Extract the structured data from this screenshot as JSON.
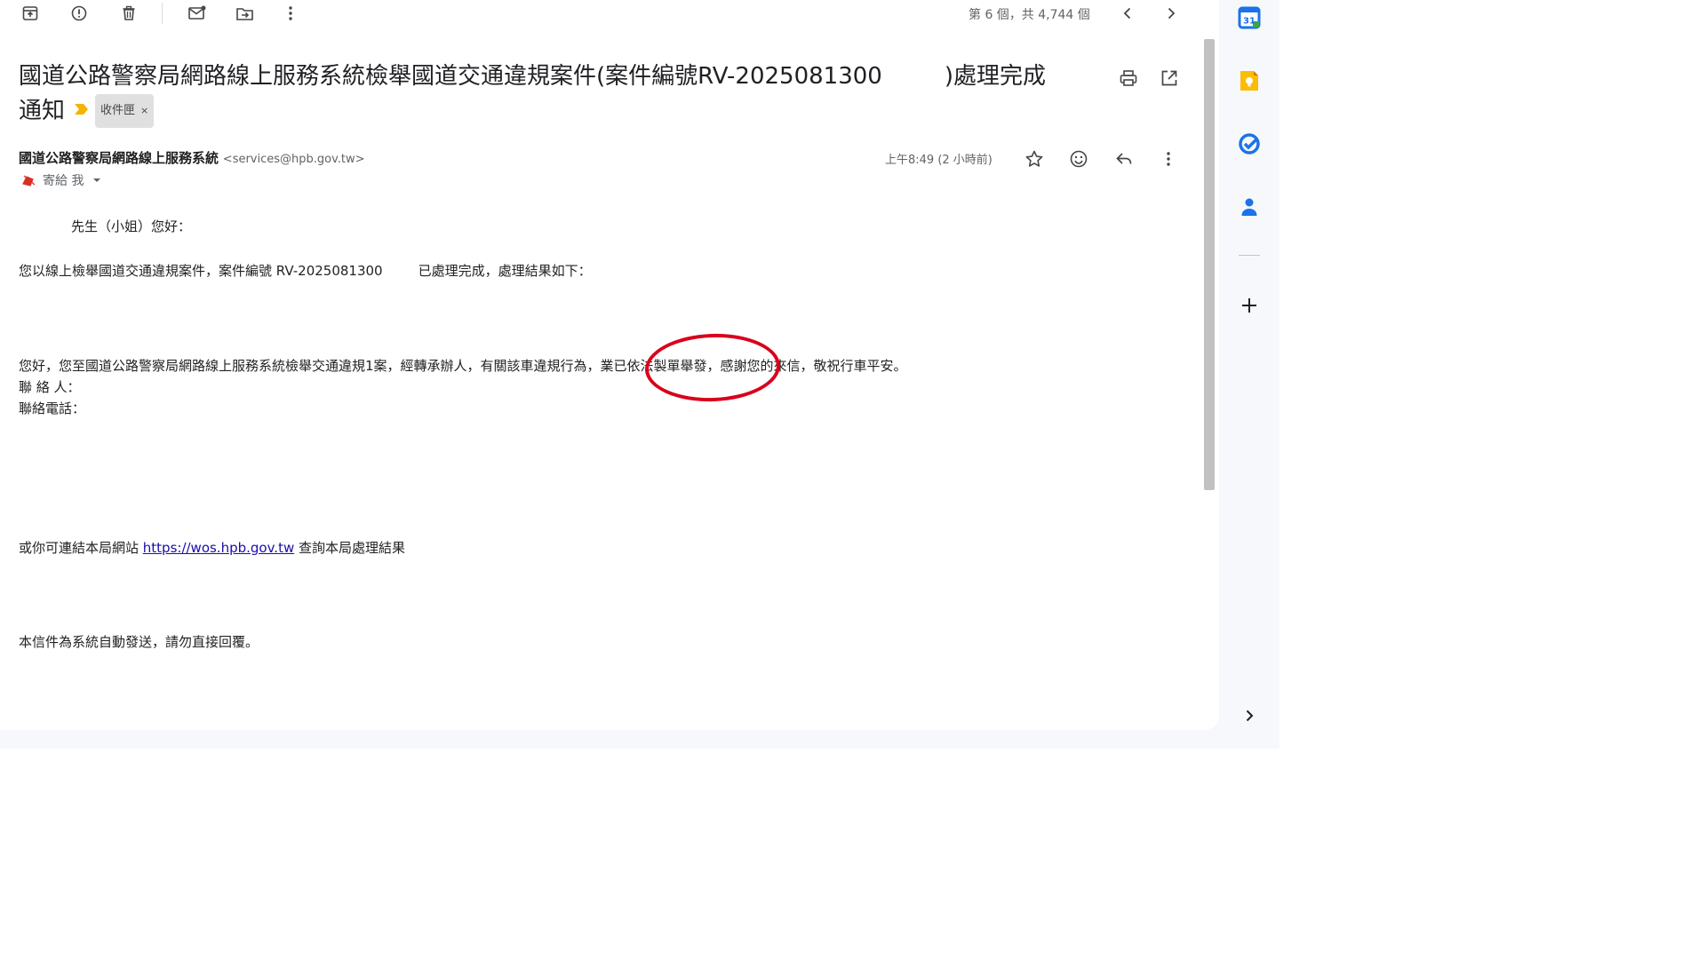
{
  "toolbar": {
    "counter": "第 6 個，共 4,744 個"
  },
  "email": {
    "subject_line1": "國道公路警察局網路線上服務系統檢舉國道交通違規案件(案件編號RV-2025081300",
    "subject_line1_end": ")處理完成",
    "subject_line2": "通知",
    "label": "收件匣",
    "label_close": "×",
    "sender_name": "國道公路警察局網路線上服務系統",
    "sender_email": "<services@hpb.gov.tw>",
    "to": "寄給 我",
    "time": "上午8:49 (2 小時前)",
    "greeting": "先生（小姐）您好：",
    "para1_a": "您以線上檢舉國道交通違規案件，案件編號 RV-2025081300",
    "para1_b": "已處理完成，處理結果如下：",
    "para2": "您好，您至國道公路警察局網路線上服務系統檢舉交通違規1案，經轉承辦人，有關該車違規行為，業已依法製單舉發，感謝您的來信，敬祝行車平安。",
    "contact": "聯 絡 人：",
    "phone": "聯絡電話：",
    "link_prefix": "或你可連結本局網站 ",
    "link_text": "https://wos.hpb.gov.tw",
    "link_suffix": " 查詢本局處理結果",
    "footer": "本信件為系統自動發送，請勿直接回覆。"
  },
  "side_panel": {
    "calendar_day": "31"
  },
  "colors": {
    "link": "#1a0dab",
    "highlight": "#d9001b",
    "importance": "#f4b400",
    "calendar_blue": "#1a73e8",
    "keep_yellow": "#fbbc04",
    "contacts_blue": "#1a73e8"
  }
}
